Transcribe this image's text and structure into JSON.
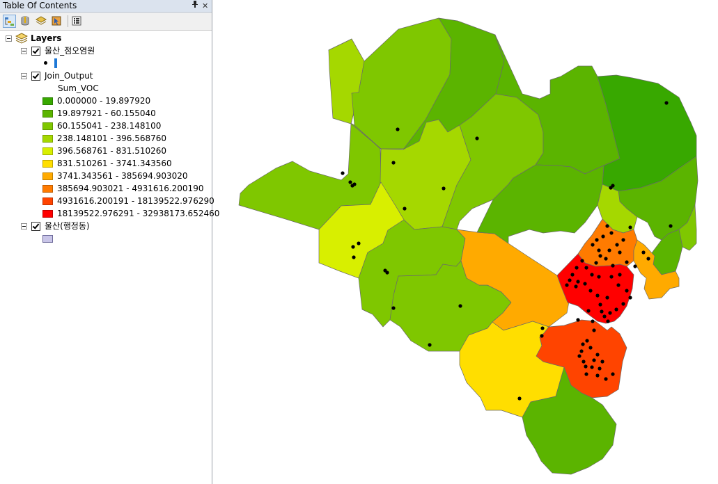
{
  "toc": {
    "title": "Table Of Contents",
    "pin_icon": "pin-icon",
    "close_icon": "close-icon",
    "toolbar": [
      "list-by-drawing-order-icon",
      "list-by-source-icon",
      "list-by-visibility-icon",
      "list-by-selection-icon",
      "options-icon"
    ],
    "root_label": "Layers",
    "layers": [
      {
        "name": "울산_점오염원",
        "checked": true
      },
      {
        "name": "Join_Output",
        "checked": true,
        "field": "Sum_VOC",
        "classes": [
          {
            "label": "0.000000 - 19.897920",
            "color": "#38a800"
          },
          {
            "label": "19.897921 - 60.155040",
            "color": "#5bb400"
          },
          {
            "label": "60.155041 - 238.148100",
            "color": "#7fc700"
          },
          {
            "label": "238.148101 - 396.568760",
            "color": "#a5d800"
          },
          {
            "label": "396.568761 - 831.510260",
            "color": "#d8ef00"
          },
          {
            "label": "831.510261 - 3741.343560",
            "color": "#ffde00"
          },
          {
            "label": "3741.343561 - 385694.903020",
            "color": "#ffaa00"
          },
          {
            "label": "385694.903021 - 4931616.200190",
            "color": "#ff7b00"
          },
          {
            "label": "4931616.200191 - 18139522.976290",
            "color": "#ff4400"
          },
          {
            "label": "18139522.976291 - 32938173.652460",
            "color": "#ff0000"
          }
        ]
      },
      {
        "name": "울산(행정동)",
        "checked": true,
        "fill": "#c9c5e8"
      }
    ]
  }
}
